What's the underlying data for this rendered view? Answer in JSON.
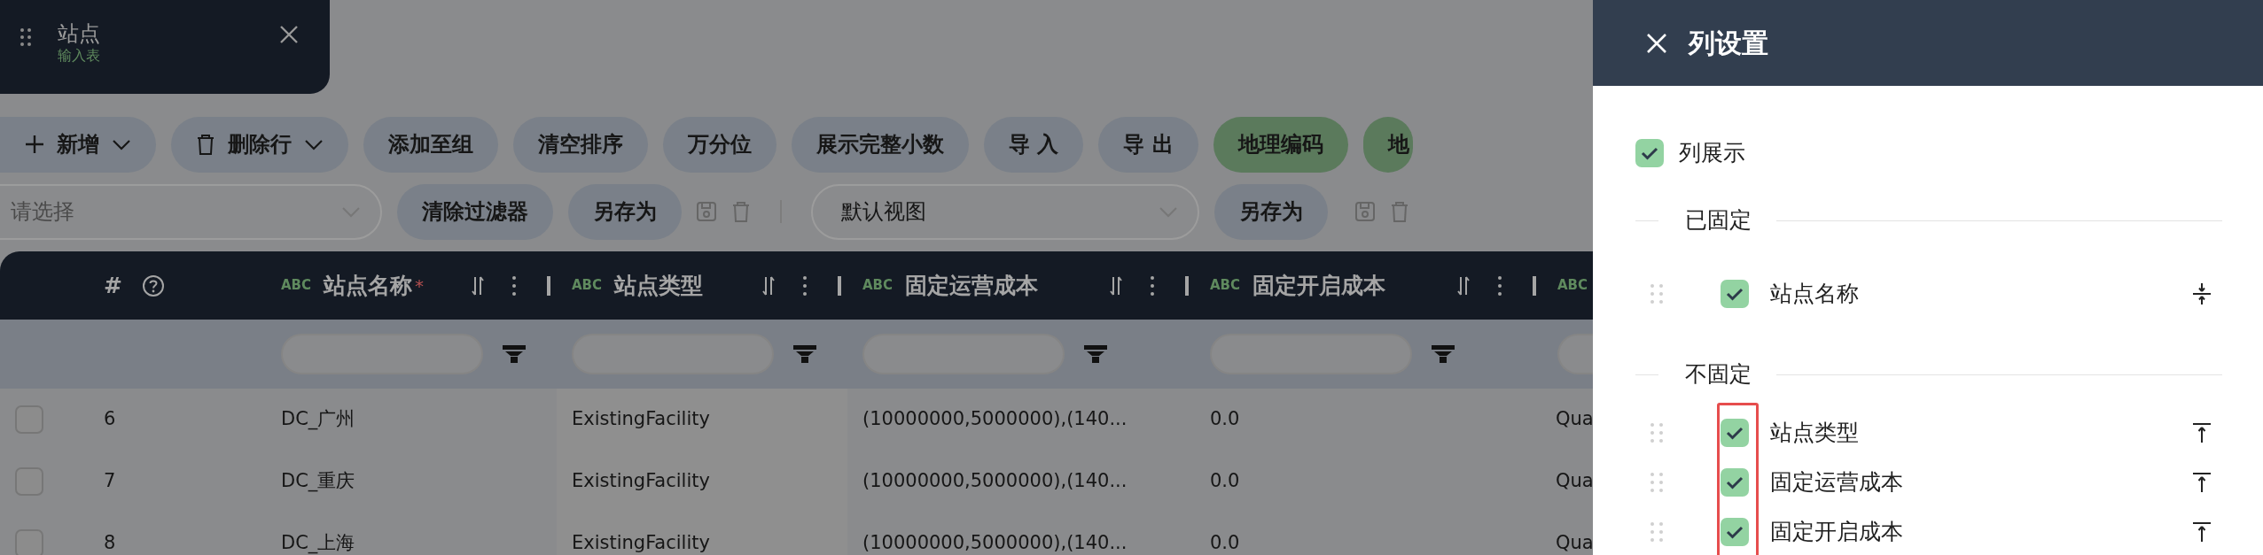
{
  "tab": {
    "title": "站点",
    "subtitle": "输入表"
  },
  "toolbar": [
    {
      "label": "新增",
      "kind": "dropdown"
    },
    {
      "label": "删除行",
      "kind": "dropdown"
    },
    {
      "label": "添加至组",
      "kind": "plain"
    },
    {
      "label": "清空排序",
      "kind": "plain"
    },
    {
      "label": "万分位",
      "kind": "plain"
    },
    {
      "label": "展示完整小数",
      "kind": "plain"
    },
    {
      "label": "导 入",
      "kind": "plain"
    },
    {
      "label": "导 出",
      "kind": "plain"
    },
    {
      "label": "地理编码",
      "kind": "accent"
    },
    {
      "label": "地",
      "kind": "accent"
    }
  ],
  "filter_bar": {
    "filter_select": {
      "placeholder": "请选择"
    },
    "clear_button": "清除过滤器",
    "save_as_button": "另存为",
    "view_select": {
      "value": "默认视图"
    },
    "view_save_as_button": "另存为"
  },
  "table": {
    "number_header": "#",
    "columns": [
      {
        "type_tag": "ABC",
        "label": "站点名称",
        "required_mark": "*"
      },
      {
        "type_tag": "ABC",
        "label": "站点类型"
      },
      {
        "type_tag": "ABC",
        "label": "固定运营成本"
      },
      {
        "type_tag": "ABC",
        "label": "固定开启成本"
      },
      {
        "type_tag": "ABC"
      }
    ],
    "rows": [
      {
        "checked": false,
        "number": "6",
        "cells": [
          "DC_广州",
          "ExistingFacility",
          "(10000000,5000000),(140...",
          "0.0",
          "Qua"
        ]
      },
      {
        "checked": false,
        "number": "7",
        "cells": [
          "DC_重庆",
          "ExistingFacility",
          "(10000000,5000000),(140...",
          "0.0",
          "Qua"
        ]
      },
      {
        "checked": false,
        "number": "8",
        "cells": [
          "DC_上海",
          "ExistingFacility",
          "(10000000,5000000),(140...",
          "0.0",
          "Qua"
        ]
      }
    ]
  },
  "drawer": {
    "title": "列设置",
    "show_columns": {
      "label": "列展示",
      "checked": true
    },
    "sections": [
      {
        "title": "已固定",
        "pinned": true,
        "highlighted": false,
        "columns": [
          {
            "label": "站点名称",
            "checked": true
          }
        ]
      },
      {
        "title": "不固定",
        "pinned": false,
        "highlighted": true,
        "columns": [
          {
            "label": "站点类型",
            "checked": true
          },
          {
            "label": "固定运营成本",
            "checked": true
          },
          {
            "label": "固定开启成本",
            "checked": true
          }
        ]
      }
    ]
  }
}
